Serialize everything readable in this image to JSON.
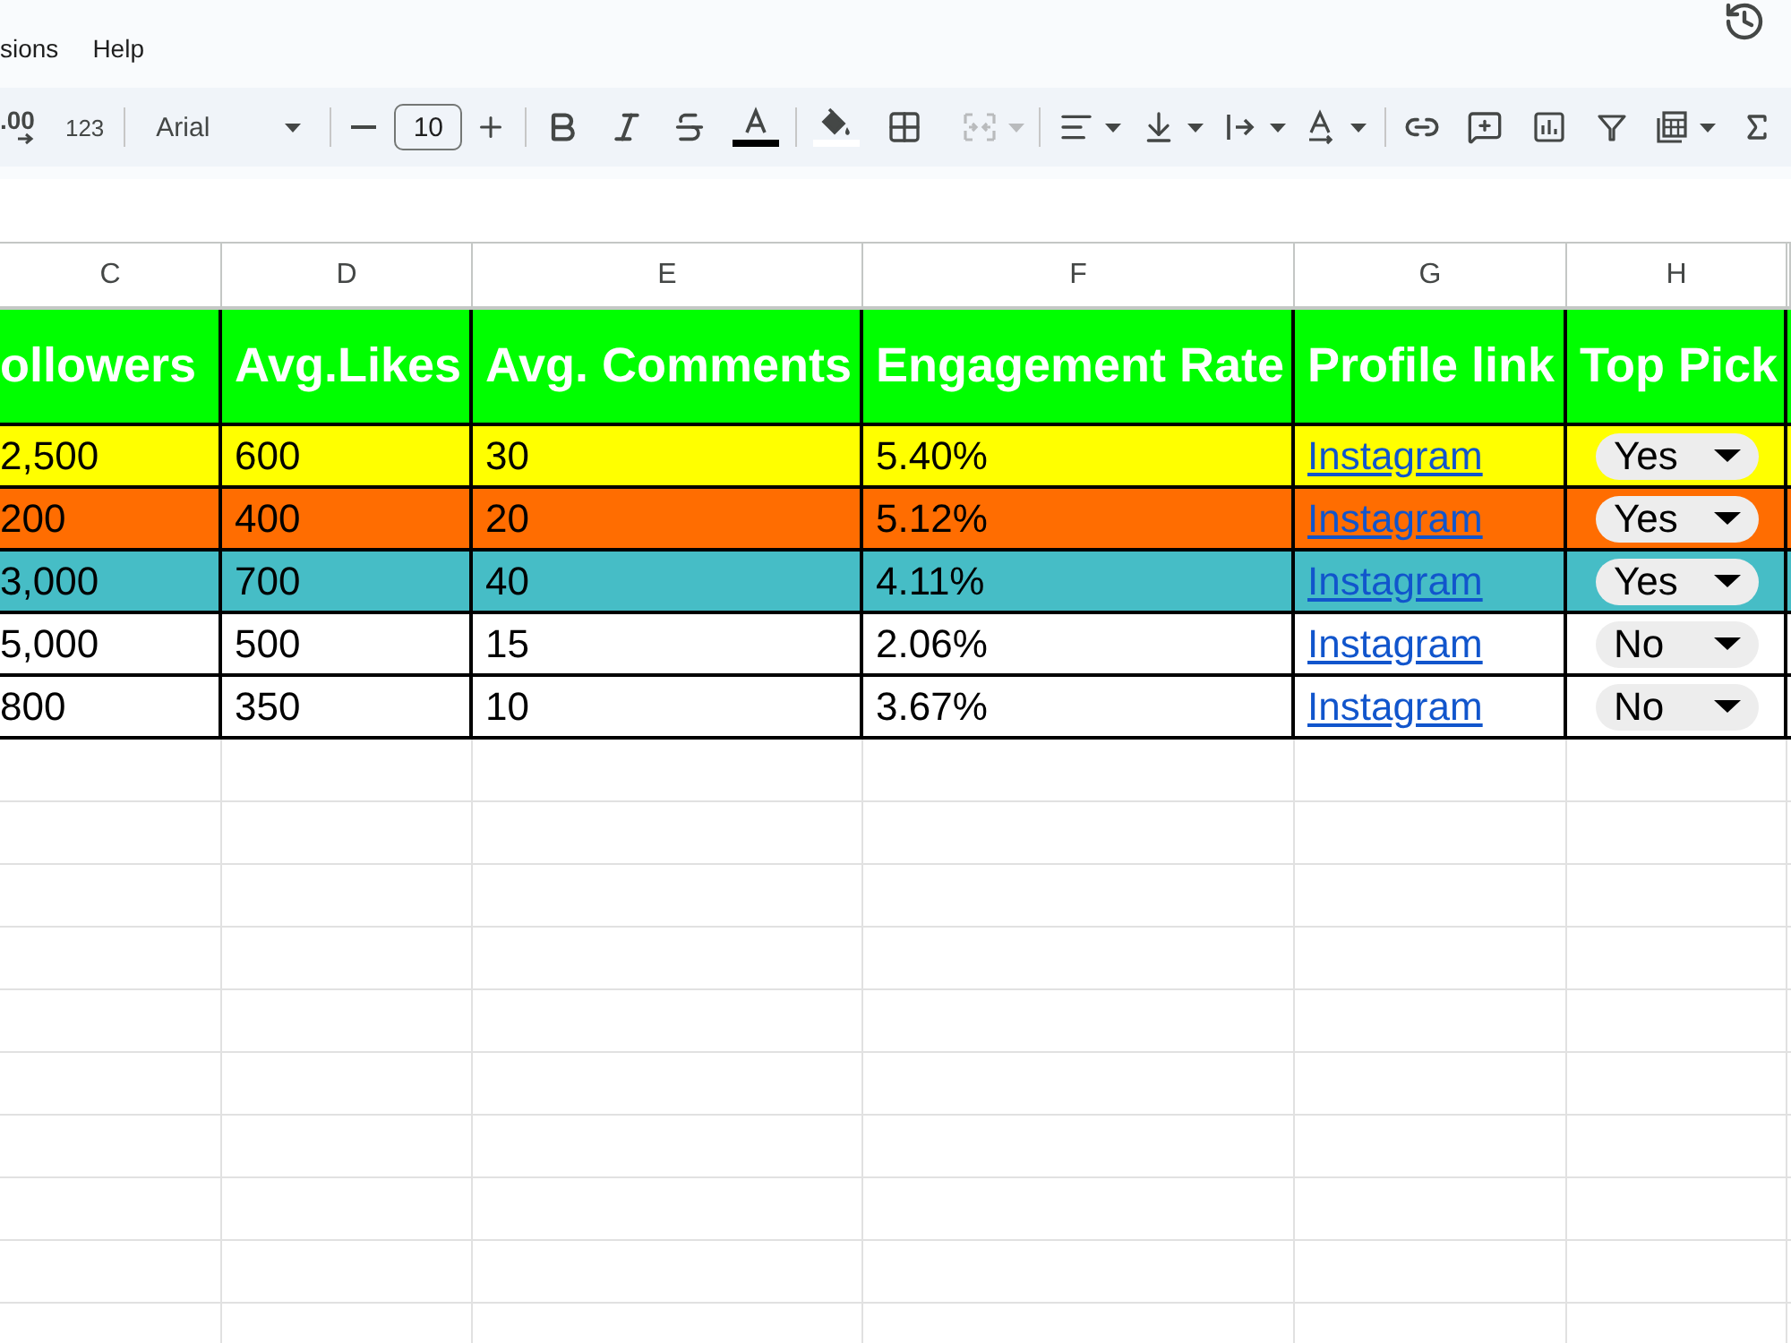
{
  "menu_bar": {
    "items": [
      "sions",
      "Help"
    ]
  },
  "toolbar": {
    "decimal_button": ".00",
    "number_format_button": "123",
    "font_family": "Arial",
    "font_size": "10",
    "merge_button": {
      "disabled": true
    }
  },
  "sheet": {
    "column_letters": [
      "C",
      "D",
      "E",
      "F",
      "G",
      "H"
    ],
    "header": [
      "ollowers",
      "Avg.Likes",
      "Avg. Comments",
      "Engagement Rate",
      "Profile link",
      "Top Pick"
    ],
    "rows": [
      {
        "color": "#ffff00",
        "followers": "2,500",
        "avg_likes": "600",
        "avg_comments": "30",
        "engagement_rate": "5.40%",
        "profile_link": "Instagram",
        "top_pick": "Yes"
      },
      {
        "color": "#ff6d01",
        "followers": "200",
        "avg_likes": "400",
        "avg_comments": "20",
        "engagement_rate": "5.12%",
        "profile_link": "Instagram",
        "top_pick": "Yes"
      },
      {
        "color": "#46bdc6",
        "followers": "3,000",
        "avg_likes": "700",
        "avg_comments": "40",
        "engagement_rate": "4.11%",
        "profile_link": "Instagram",
        "top_pick": "Yes"
      },
      {
        "color": "#ffffff",
        "followers": "5,000",
        "avg_likes": "500",
        "avg_comments": "15",
        "engagement_rate": "2.06%",
        "profile_link": "Instagram",
        "top_pick": "No"
      },
      {
        "color": "#ffffff",
        "followers": "800",
        "avg_likes": "350",
        "avg_comments": "10",
        "engagement_rate": "3.67%",
        "profile_link": "Instagram",
        "top_pick": "No"
      }
    ]
  }
}
